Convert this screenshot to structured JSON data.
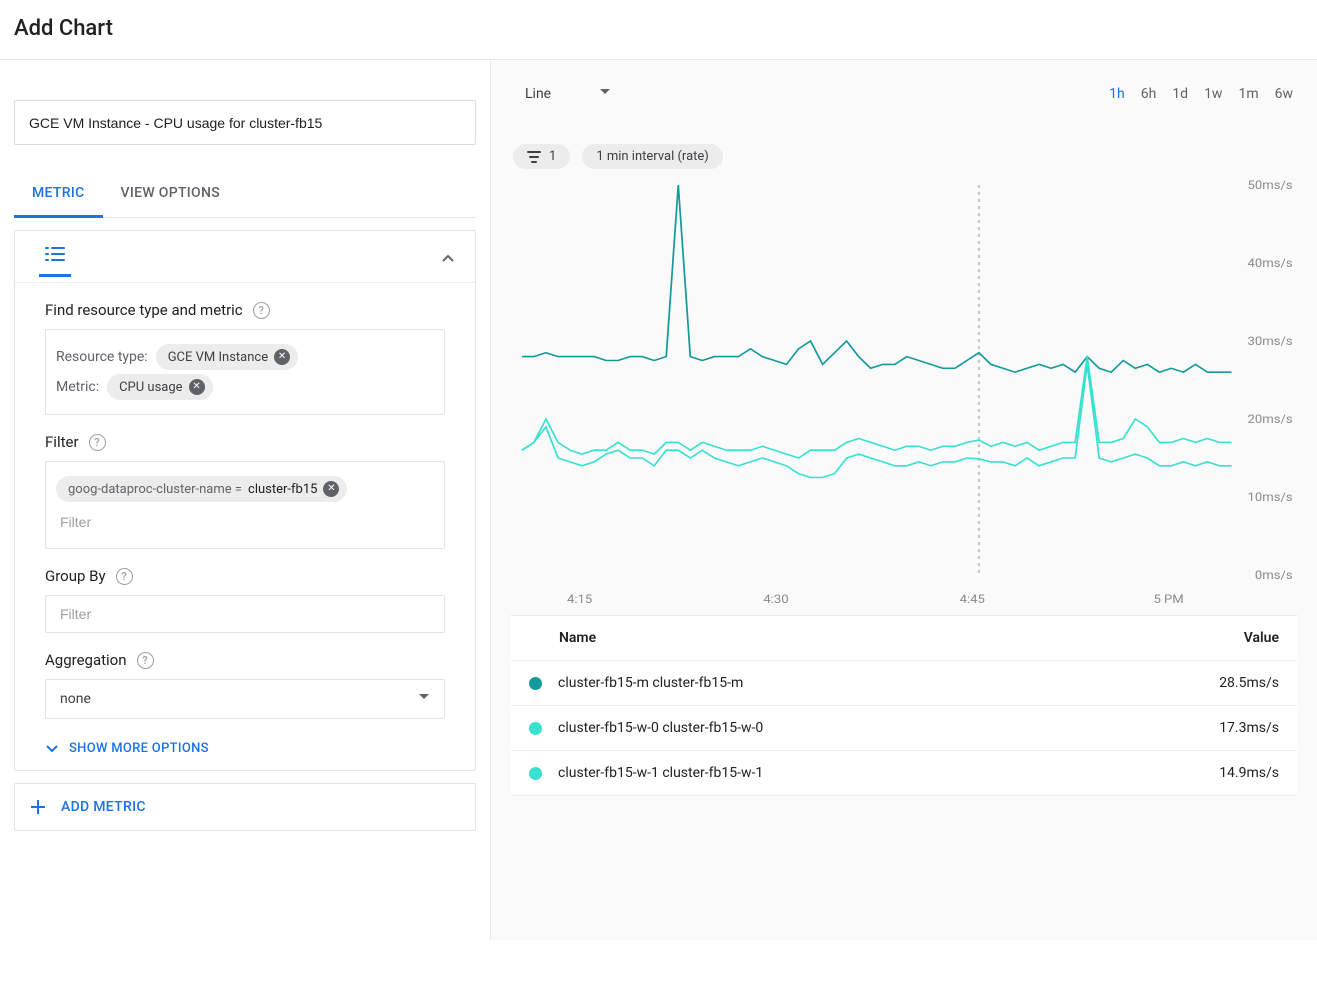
{
  "page_title": "Add Chart",
  "chart_title_value": "GCE VM Instance - CPU usage for cluster-fb15",
  "tabs": {
    "metric": "METRIC",
    "view_options": "VIEW OPTIONS",
    "active": "metric"
  },
  "sections": {
    "find": {
      "label": "Find resource type and metric",
      "resource_type_label": "Resource type:",
      "resource_type_value": "GCE VM Instance",
      "metric_label": "Metric:",
      "metric_value": "CPU usage"
    },
    "filter": {
      "label": "Filter",
      "chip_key": "goog-dataproc-cluster-name = ",
      "chip_val": "cluster-fb15",
      "placeholder": "Filter"
    },
    "groupby": {
      "label": "Group By",
      "placeholder": "Filter"
    },
    "aggregation": {
      "label": "Aggregation",
      "value": "none"
    },
    "show_more": "SHOW MORE OPTIONS",
    "add_metric": "ADD METRIC"
  },
  "chart_panel": {
    "vis_type": "Line",
    "ranges": [
      "1h",
      "6h",
      "1d",
      "1w",
      "1m",
      "6w"
    ],
    "range_active": "1h",
    "chip1": "1",
    "chip2": "1 min interval (rate)",
    "legend_header_name": "Name",
    "legend_header_value": "Value"
  },
  "legend": [
    {
      "name": "cluster-fb15-m cluster-fb15-m",
      "value": "28.5ms/s",
      "color": "#159a9c"
    },
    {
      "name": "cluster-fb15-w-0 cluster-fb15-w-0",
      "value": "17.3ms/s",
      "color": "#38e1cf"
    },
    {
      "name": "cluster-fb15-w-1 cluster-fb15-w-1",
      "value": "14.9ms/s",
      "color": "#38e1cf"
    }
  ],
  "chart_data": {
    "type": "line",
    "title": "GCE VM Instance - CPU usage for cluster-fb15",
    "xlabel": "",
    "ylabel": "",
    "y_unit": "ms/s",
    "ylim": [
      0,
      50
    ],
    "x_ticks": [
      "4:15",
      "4:30",
      "4:45",
      "5 PM"
    ],
    "y_ticks": [
      0,
      10,
      20,
      30,
      40,
      50
    ],
    "cursor_at": 38,
    "x": [
      0,
      1,
      2,
      3,
      4,
      5,
      6,
      7,
      8,
      9,
      10,
      11,
      12,
      13,
      14,
      15,
      16,
      17,
      18,
      19,
      20,
      21,
      22,
      23,
      24,
      25,
      26,
      27,
      28,
      29,
      30,
      31,
      32,
      33,
      34,
      35,
      36,
      37,
      38,
      39,
      40,
      41,
      42,
      43,
      44,
      45,
      46,
      47,
      48,
      49,
      50,
      51,
      52,
      53,
      54,
      55,
      56,
      57,
      58,
      59
    ],
    "series": [
      {
        "name": "cluster-fb15-m",
        "color": "#159a9c",
        "values": [
          28,
          28,
          28.5,
          28,
          28,
          28,
          28,
          27.5,
          27.5,
          28,
          28,
          27.5,
          28,
          50,
          28,
          27.5,
          28,
          28,
          28,
          29,
          28,
          27.5,
          27,
          29,
          30,
          27,
          28.5,
          30,
          28,
          26.5,
          27,
          27,
          28,
          27.5,
          27,
          26.5,
          26.5,
          27.5,
          28.5,
          27,
          26.5,
          26,
          26.5,
          27,
          26.5,
          27,
          26,
          28,
          26.5,
          26,
          27.5,
          26.5,
          27,
          26,
          26.5,
          26,
          27,
          26,
          26,
          26
        ]
      },
      {
        "name": "cluster-fb15-w-0",
        "color": "#38e1cf",
        "values": [
          16,
          17,
          20,
          17,
          16,
          15.5,
          16,
          16,
          17,
          16,
          16,
          15.5,
          17,
          17,
          16,
          17,
          16.5,
          16,
          16,
          16,
          16.5,
          16,
          15.5,
          15,
          16,
          16,
          16,
          17,
          17.5,
          17,
          16.5,
          16,
          16.5,
          16.5,
          16,
          16.5,
          16.5,
          17,
          17.3,
          16.5,
          17,
          16.5,
          17,
          16,
          16.5,
          17,
          17,
          28,
          17,
          17,
          17.5,
          20,
          19,
          17,
          17,
          17.5,
          17,
          17.5,
          17,
          17
        ]
      },
      {
        "name": "cluster-fb15-w-1",
        "color": "#38e1cf",
        "values": [
          16,
          17,
          19,
          15,
          14.5,
          14,
          14.5,
          15.5,
          16,
          15,
          15,
          14,
          16,
          16,
          15,
          16,
          15,
          14.5,
          14,
          14.5,
          15,
          14.5,
          14,
          13,
          12.5,
          12.5,
          13,
          15,
          15.5,
          15,
          14.5,
          14,
          14,
          14.5,
          14,
          14.5,
          14.5,
          15,
          14.9,
          14.5,
          14.5,
          14,
          15,
          14,
          14.5,
          15,
          15,
          27,
          15,
          14.5,
          15,
          15.5,
          15,
          14,
          14,
          14.5,
          14,
          14.5,
          14,
          14
        ]
      }
    ]
  }
}
